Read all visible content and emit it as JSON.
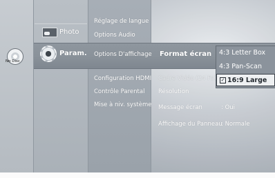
{
  "disc": {
    "label": "No Disc",
    "icon": "disc-icon"
  },
  "main_menu": {
    "photo": "Photo",
    "param": "Param."
  },
  "sub_menu": {
    "items": [
      "Réglage de langue",
      "Options Audio",
      "Options D'affichage",
      "Configuration HDMI",
      "Contrôle Parental",
      "Mise à niv. système"
    ]
  },
  "settings": {
    "format_ecran": "Format écran",
    "cadre_video": "Cadre Vidéo (24 Fs)",
    "resolution": "Résolution",
    "message_ecran": "Message écran",
    "message_value": ": Oui",
    "affichage_panneau": "Affichage du Panneau",
    "affichage_value": ": Normale"
  },
  "popup": {
    "options": [
      "4:3 Letter Box",
      "4:3 Pan-Scan",
      "16:9 Large"
    ],
    "selected": "16:9 Large",
    "check_icon": "check-icon"
  },
  "colors": {
    "background": "#a6adb5",
    "highlight": "#8a929a",
    "text": "#ffffff",
    "popup_selected_bg": "#eef0f2"
  }
}
